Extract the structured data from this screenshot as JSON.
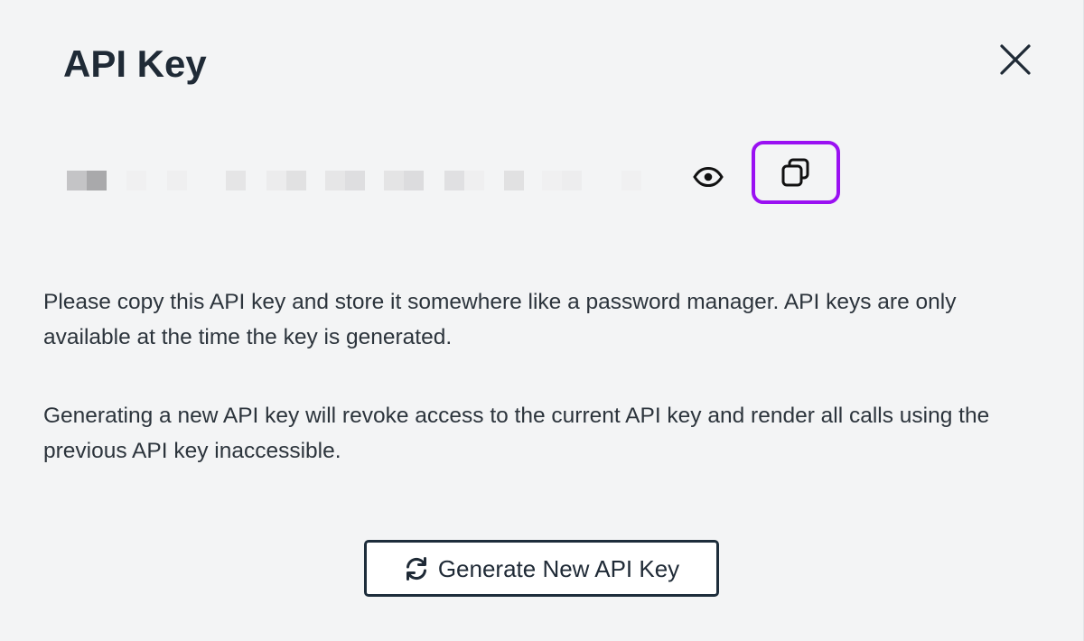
{
  "modal": {
    "title": "API Key",
    "close_icon": "close-icon"
  },
  "api_key": {
    "masked": true,
    "reveal_icon": "eye-icon",
    "copy_icon": "copy-icon",
    "copy_highlight_color": "#9a10f2"
  },
  "info": {
    "paragraph_1": "Please copy this API key and store it somewhere like a password manager. API keys are only available at the time the key is generated.",
    "paragraph_2": "Generating a new API key will revoke access to the current API key and render all calls using the previous API key inaccessible."
  },
  "generate_button": {
    "label": "Generate New API Key",
    "icon": "refresh-icon"
  }
}
